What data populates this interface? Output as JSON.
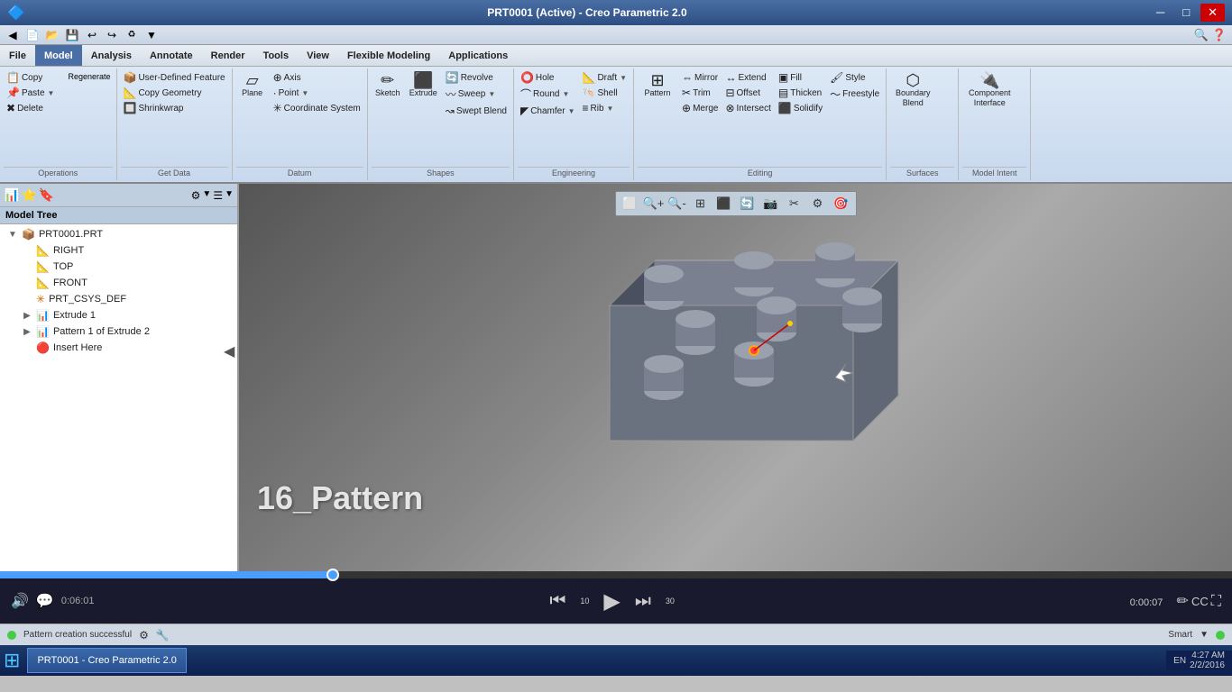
{
  "titlebar": {
    "title": "PRT0001 (Active) - Creo Parametric 2.0",
    "minimize": "─",
    "maximize": "□",
    "close": "✕"
  },
  "quickbar": {
    "buttons": [
      "◀",
      "💾",
      "↩",
      "↪",
      "📋",
      "▼"
    ]
  },
  "menubar": {
    "items": [
      "File",
      "Model",
      "Analysis",
      "Annotate",
      "Render",
      "Tools",
      "View",
      "Flexible Modeling",
      "Applications"
    ]
  },
  "ribbon": {
    "tabs": [
      "File",
      "Model",
      "Analysis",
      "Annotate",
      "Render",
      "Tools",
      "View",
      "Flexible Modeling",
      "Applications"
    ],
    "active_tab": "Model",
    "groups": {
      "operations": {
        "label": "Operations",
        "buttons": [
          "Copy",
          "Paste",
          "Delete"
        ]
      },
      "get_data": {
        "label": "Get Data",
        "buttons": [
          "User-Defined Feature",
          "Copy Geometry",
          "Shrinkwrap"
        ]
      },
      "datum": {
        "label": "Datum",
        "buttons": [
          "Plane",
          "Axis",
          "Point",
          "Coordinate System"
        ]
      },
      "shapes": {
        "label": "Shapes",
        "buttons": [
          "Sketch",
          "Extrude",
          "Revolve",
          "Sweep",
          "Swept Blend"
        ]
      },
      "engineering": {
        "label": "Engineering",
        "buttons": [
          "Hole",
          "Round",
          "Chamfer",
          "Draft",
          "Shell",
          "Rib"
        ]
      },
      "editing": {
        "label": "Editing",
        "buttons": [
          "Mirror",
          "Extend",
          "Trim",
          "Offset",
          "Merge",
          "Intersect",
          "Pattern",
          "Fill",
          "Style",
          "Thicken",
          "Solidify",
          "Freestyle"
        ]
      },
      "surfaces": {
        "label": "Surfaces",
        "buttons": [
          "Boundary Blend"
        ]
      },
      "model_intent": {
        "label": "Model Intent",
        "buttons": [
          "Component Interface"
        ]
      }
    }
  },
  "sidebar": {
    "title": "Model Tree",
    "toolbar_buttons": [
      "⚙",
      "▼",
      "☰",
      "▼"
    ],
    "items": [
      {
        "label": "PRT0001.PRT",
        "icon": "📦",
        "indent": 0,
        "expanded": true
      },
      {
        "label": "RIGHT",
        "icon": "📐",
        "indent": 1
      },
      {
        "label": "TOP",
        "icon": "📐",
        "indent": 1
      },
      {
        "label": "FRONT",
        "icon": "📐",
        "indent": 1
      },
      {
        "label": "PRT_CSYS_DEF",
        "icon": "✳",
        "indent": 1
      },
      {
        "label": "Extrude 1",
        "icon": "📊",
        "indent": 1,
        "expandable": true
      },
      {
        "label": "Pattern 1 of Extrude 2",
        "icon": "📊",
        "indent": 1,
        "expandable": true
      },
      {
        "label": "Insert Here",
        "icon": "🔴",
        "indent": 1
      }
    ]
  },
  "viewport": {
    "watermark": "16_Pattern",
    "toolbar_buttons": [
      "🔍",
      "🔍+",
      "🔍-",
      "⬜",
      "⬜+",
      "🔄",
      "📷",
      "✂",
      "⚙",
      "🎯"
    ]
  },
  "video_controls": {
    "progress_percent": 27,
    "current_time": "0:06:01",
    "end_time": "0:00:07",
    "buttons": {
      "rewind10": "⏮10",
      "play": "▶",
      "forward30": "⏭30",
      "volume": "🔊",
      "chat": "💬",
      "edit": "✏",
      "caption": "CC",
      "fullscreen": "⛶"
    }
  },
  "statusbar": {
    "left_text": "Pattern creation successful",
    "smart_label": "Smart",
    "icons": [
      "⚙",
      "🔧"
    ]
  },
  "taskbar": {
    "time": "4:27 AM",
    "date": "2/2/2016",
    "language": "EN",
    "app_button": "PRT0001 - Creo Parametric 2.0"
  }
}
